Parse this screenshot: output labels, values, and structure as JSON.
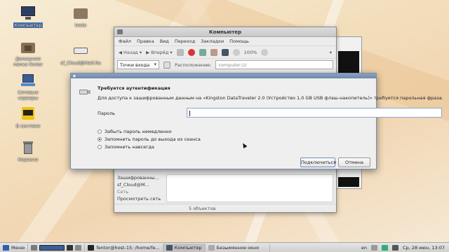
{
  "desktop": {
    "icons": [
      {
        "label": "Компьютер"
      },
      {
        "label": "Домашняя папка fentor"
      },
      {
        "label": "Сетевые серверы"
      },
      {
        "label": "В системе"
      },
      {
        "label": "Корзина"
      },
      {
        "label": "testo"
      },
      {
        "label": "sf_Cloud@Mail.Ru"
      }
    ]
  },
  "file_manager": {
    "title": "Компьютер",
    "menu": [
      "Файл",
      "Правка",
      "Вид",
      "Переход",
      "Закладки",
      "Помощь"
    ],
    "toolbar": {
      "back_label": "Назад",
      "forward_label": "Вперёд",
      "zoom_label": "100%"
    },
    "location": {
      "mode_label": "Точки входа",
      "label": "Расположение:",
      "value": "computer:///"
    },
    "sidebar": {
      "items": [
        "Зашифрованны...",
        "sf_Cloud@M...",
        "Сеть",
        "Просмотреть сеть"
      ]
    },
    "status": "5 объектов"
  },
  "auth_dialog": {
    "heading": "Требуется аутентификация",
    "description": "Для доступа к зашифрованным данным на «Kingston DataTraveler 2.0 (Устройство 1,0 GB USB флэш-накопитель)» требуется парольная фраза.",
    "password_label": "Пароль",
    "password_value": "",
    "options": [
      {
        "label": "Забыть пароль немедленно",
        "selected": false
      },
      {
        "label": "Запомнить пароль до выхода из сеанса",
        "selected": true
      },
      {
        "label": "Запомнить навсегда",
        "selected": false
      }
    ],
    "connect_label": "Подключиться",
    "cancel_label": "Отмена"
  },
  "taskbar": {
    "menu_label": "Меню",
    "tasks": [
      {
        "label": "fentor@host-15: /home/fe..."
      },
      {
        "label": "Компьютер"
      },
      {
        "label": "Безымянное окно"
      }
    ],
    "lang": "en",
    "clock": "Ср, 28 июн, 13:07"
  },
  "colors": {
    "selection": "#4a78b5",
    "dialog_titlebar": "#7a93b5"
  }
}
